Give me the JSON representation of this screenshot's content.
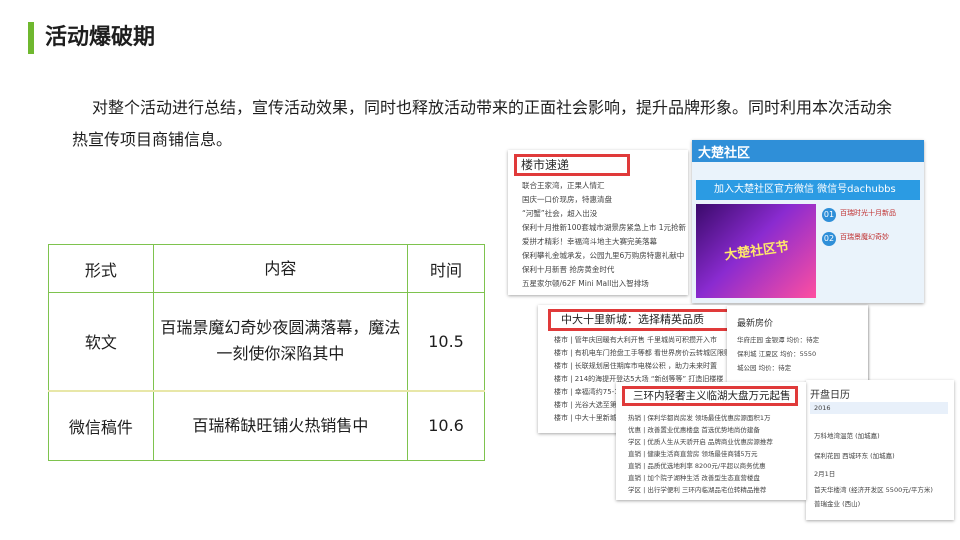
{
  "header": {
    "title": "活动爆破期"
  },
  "intro": "对整个活动进行总结，宣传活动效果，同时也释放活动带来的正面社会影响，提升品牌形象。同时利用本次活动余热宣传项目商铺信息。",
  "table": {
    "headers": [
      "形式",
      "内容",
      "时间"
    ],
    "rows": [
      {
        "form": "软文",
        "content": "百瑞景魔幻奇妙夜圆满落幕，魔法一刻使你深陷其中",
        "time": "10.5"
      },
      {
        "form": "微信稿件",
        "content": "百瑞稀缺旺铺火热销售中",
        "time": "10.6"
      }
    ]
  },
  "collage": {
    "shot_a": {
      "title": "楼市速递",
      "lines": [
        "联合王家湾，正果人情汇",
        "国庆一口价现房，特惠清盘",
        "“河蟹”社会，超入出没",
        "保利十月推新100套城市湖景房紧急上市 1元抢新",
        "爱拼才精彩！幸福湾斗地主大赛完美落幕",
        "保利攀礼金城承发，公园九里6万购房特惠礼献中",
        "保利十月新晋 抢房黄金时代",
        "五星家尔顿/62F Mini Mall出入智排场"
      ]
    },
    "shot_b": {
      "brand": "大楚社区",
      "banner": "加入大楚社区官方微信 微信号dachubbs",
      "poster": "大楚社区节",
      "items": [
        {
          "num": "01",
          "text": "百瑞时光十月新品"
        },
        {
          "num": "02",
          "text": "百瑞景魔幻奇妙"
        }
      ]
    },
    "shot_c": {
      "title": "中大十里新城：选择精英品质",
      "lines": [
        "楼市 | 管年庆回暖有大利开售 千里城尚可积攒开入市",
        "楼市 | 有机电车门抢盘工手等都 看世界房价云转城区限购",
        "楼市 | 长联规划居住期库市电梯公积 ，助力未来时置",
        "楼市 | 214的海提开登达5大场 “新创等等” 打造旧楼楼",
        "楼市 | 幸福湾约75-115m",
        "楼市 | 光谷大选至第二期",
        "楼市 | 中大十里新城：万"
      ]
    },
    "shot_d": {
      "title": "开盘日历",
      "lines": [
        "2016",
        "万科地湾温范 (加城嘉)",
        "保利花园 西城环东 (加城嘉)",
        "2月1日",
        "首天华楼湾 (经济开发区 5500元/平方米)",
        "普瑞金业 (西山)"
      ]
    },
    "shot_e": {
      "title": "三环内轻奢主义临湖大盘万元起售",
      "lines": [
        "热销 | 保利华都尚房发 领场最佳优惠房源面积1万",
        "优惠 | 改善置业优惠楼盘 首选优势地尚仿建备",
        "学区 | 优质人生从天骄开启 品牌商业优惠房源推荐",
        "直销 | 健康生活商直营房 领场最佳商铺5万元",
        "直销 | 品质优选地利率 8200元/平超以商务优惠",
        "直销 | 加个院子湖种生活 改善型生态直营楼盘",
        "学区 | 出行学便利 三环内临湖品宅位转精品推荐"
      ]
    },
    "shot_f": {
      "title": "最新房价",
      "lines": [
        "华府庄园 金银潭 均价：待定",
        "保利城 江夏区 均价：5550",
        "城公园 均价：待定"
      ]
    }
  },
  "colors": {
    "accent": "#6fb82f",
    "table_border": "#7ec34e",
    "highlight_box": "#e03a3a"
  }
}
